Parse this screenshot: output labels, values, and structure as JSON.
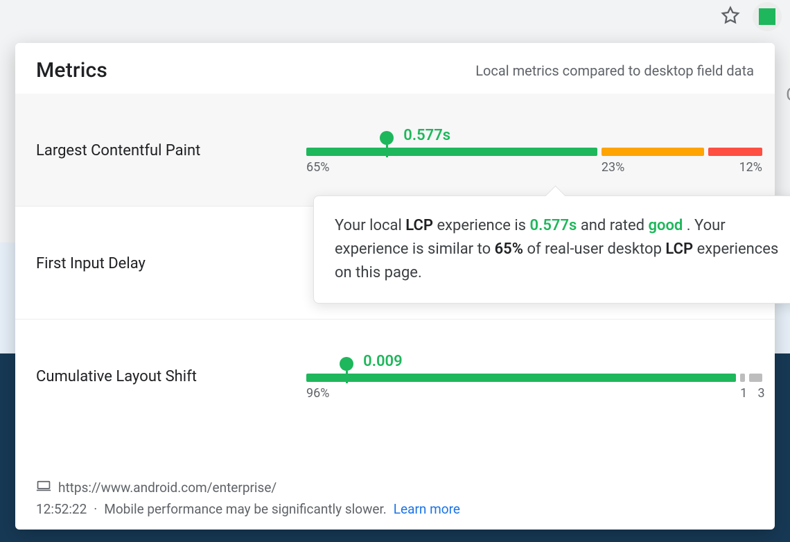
{
  "header": {
    "title": "Metrics",
    "subtitle": "Local metrics compared to desktop field data"
  },
  "metrics": [
    {
      "name": "Largest Contentful Paint",
      "value": "0.577s",
      "pointer_pct": 18,
      "segments": [
        {
          "kind": "good",
          "pct": 65,
          "label": "65%"
        },
        {
          "kind": "warn",
          "pct": 23,
          "label": "23%"
        },
        {
          "kind": "bad",
          "pct": 12,
          "label": "12%"
        }
      ],
      "selected": true
    },
    {
      "name": "First Input Delay",
      "value": "",
      "pointer_pct": null,
      "segments": [],
      "selected": false
    },
    {
      "name": "Cumulative Layout Shift",
      "value": "0.009",
      "pointer_pct": 9,
      "segments": [
        {
          "kind": "good",
          "pct": 96,
          "label": "96%"
        },
        {
          "kind": "mute",
          "pct": 1,
          "label": "1"
        },
        {
          "kind": "mute",
          "pct": 3,
          "label": "3"
        }
      ],
      "selected": false
    }
  ],
  "tooltip": {
    "t1": "Your local ",
    "abbr1": "LCP",
    "t2": " experience is ",
    "val": "0.577s",
    "t3": " and rated ",
    "rating": "good",
    "t4": ". Your experience is similar to ",
    "similar_pct": "65%",
    "t5": " of real-user desktop ",
    "abbr2": "LCP",
    "t6": " experiences on this page."
  },
  "footer": {
    "url": "https://www.android.com/enterprise/",
    "time": "12:52:22",
    "sep": "·",
    "warning": "Mobile performance may be significantly slower.",
    "learn_more": "Learn more"
  }
}
